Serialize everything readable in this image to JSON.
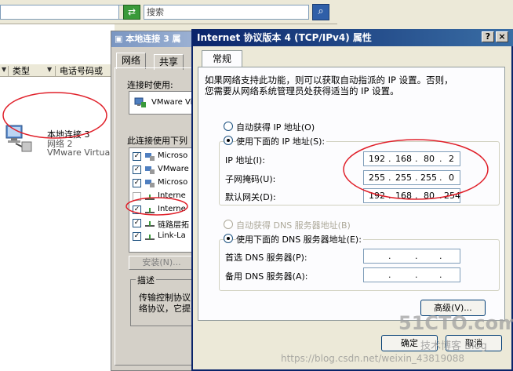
{
  "explorer": {
    "search_placeholder": "搜索",
    "columns": [
      "类型",
      "电话号码或"
    ],
    "connection": {
      "name": "本地连接 3",
      "status": "网络 2",
      "device": "VMware Virtual"
    }
  },
  "local_dialog": {
    "title": "本地连接 3 属",
    "tabs": [
      "网络",
      "共享"
    ],
    "connect_using_label": "连接时使用:",
    "adapter_name": "VMware Vi",
    "items_label": "此连接使用下列",
    "items": [
      {
        "label": "Microso",
        "checked": true
      },
      {
        "label": "VMware",
        "checked": true
      },
      {
        "label": "Microso",
        "checked": true
      },
      {
        "label": "Interne",
        "checked": false
      },
      {
        "label": "Interne",
        "checked": true
      },
      {
        "label": "链路层拓",
        "checked": true
      },
      {
        "label": "Link-La",
        "checked": true
      }
    ],
    "install_button": "安装(N)...",
    "description_legend": "描述",
    "description_lines": [
      "传输控制协议",
      "络协议，它提"
    ]
  },
  "tcpip_dialog": {
    "title": "Internet 协议版本 4 (TCP/IPv4) 属性",
    "help_button": "?",
    "close_button": "×",
    "tab_general": "常规",
    "intro_line1": "如果网络支持此功能，则可以获取自动指派的 IP 设置。否则，",
    "intro_line2": "您需要从网络系统管理员处获得适当的 IP 设置。",
    "radio_auto_ip": "自动获得 IP 地址(O)",
    "radio_manual_ip": "使用下面的 IP 地址(S):",
    "ip_address_label": "IP 地址(I):",
    "subnet_mask_label": "子网掩码(U):",
    "gateway_label": "默认网关(D):",
    "ip_address": [
      "192",
      "168",
      "80",
      "2"
    ],
    "subnet_mask": [
      "255",
      "255",
      "255",
      "0"
    ],
    "gateway": [
      "192",
      "168",
      "80",
      "254"
    ],
    "radio_auto_dns": "自动获得 DNS 服务器地址(B)",
    "radio_manual_dns": "使用下面的 DNS 服务器地址(E):",
    "preferred_dns_label": "首选 DNS 服务器(P):",
    "alternate_dns_label": "备用 DNS 服务器(A):",
    "advanced_button": "高级(V)...",
    "ok_button": "确定",
    "cancel_button": "取消"
  },
  "watermark": {
    "logo": "51CTO.com",
    "subtitle": "技术博客 Blog",
    "url": "https://blog.csdn.net/weixin_43819088"
  },
  "colors": {
    "annotation": "#e0202a",
    "title_active": "#0a246a",
    "title_inactive": "#7a96c2"
  }
}
